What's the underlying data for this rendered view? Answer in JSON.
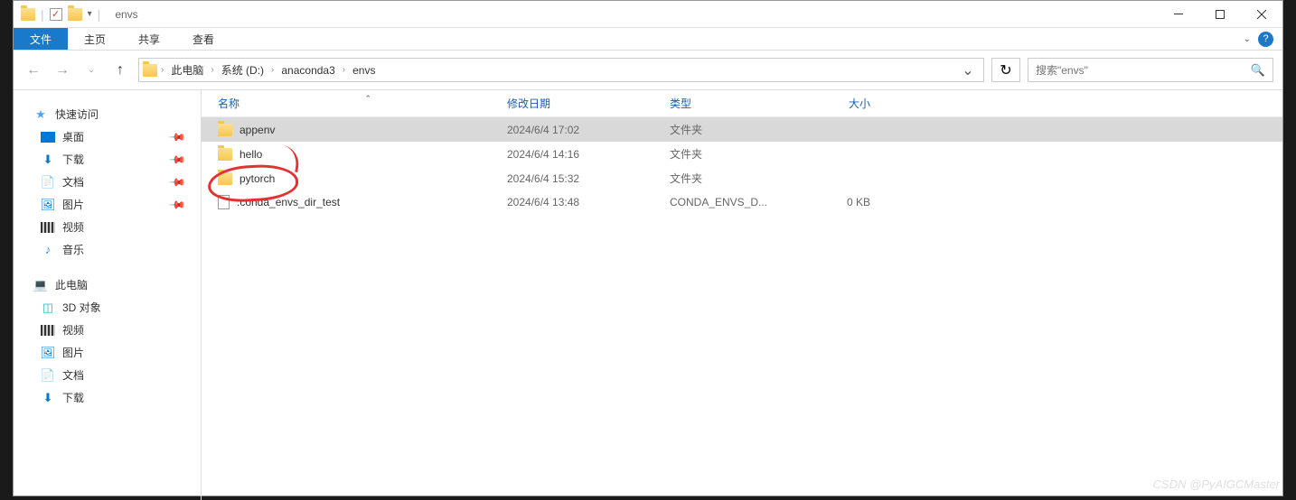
{
  "title": "envs",
  "ribbon": {
    "file": "文件",
    "home": "主页",
    "share": "共享",
    "view": "查看"
  },
  "breadcrumb": [
    "此电脑",
    "系统 (D:)",
    "anaconda3",
    "envs"
  ],
  "search_placeholder": "搜索\"envs\"",
  "columns": {
    "name": "名称",
    "date": "修改日期",
    "type": "类型",
    "size": "大小"
  },
  "sidebar": {
    "quick_access": "快速访问",
    "quick_items": [
      {
        "label": "桌面",
        "icon": "desktop",
        "pinned": true
      },
      {
        "label": "下载",
        "icon": "download",
        "pinned": true
      },
      {
        "label": "文档",
        "icon": "doc",
        "pinned": true
      },
      {
        "label": "图片",
        "icon": "pic",
        "pinned": true
      },
      {
        "label": "视频",
        "icon": "video",
        "pinned": false
      },
      {
        "label": "音乐",
        "icon": "music",
        "pinned": false
      }
    ],
    "this_pc": "此电脑",
    "pc_items": [
      {
        "label": "3D 对象",
        "icon": "3d"
      },
      {
        "label": "视频",
        "icon": "video"
      },
      {
        "label": "图片",
        "icon": "pic"
      },
      {
        "label": "文档",
        "icon": "doc"
      },
      {
        "label": "下载",
        "icon": "download"
      }
    ]
  },
  "files": [
    {
      "name": "appenv",
      "date": "2024/6/4 17:02",
      "type": "文件夹",
      "size": "",
      "kind": "folder",
      "selected": true
    },
    {
      "name": "hello",
      "date": "2024/6/4 14:16",
      "type": "文件夹",
      "size": "",
      "kind": "folder",
      "selected": false
    },
    {
      "name": "pytorch",
      "date": "2024/6/4 15:32",
      "type": "文件夹",
      "size": "",
      "kind": "folder",
      "selected": false
    },
    {
      "name": ".conda_envs_dir_test",
      "date": "2024/6/4 13:48",
      "type": "CONDA_ENVS_D...",
      "size": "0 KB",
      "kind": "file",
      "selected": false
    }
  ],
  "watermark": "CSDN @PyAIGCMaster"
}
